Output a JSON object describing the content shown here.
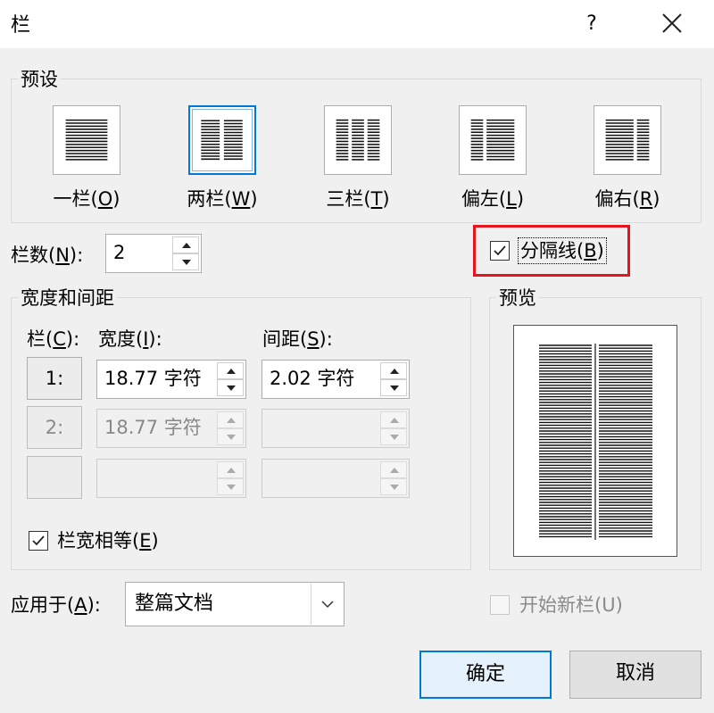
{
  "dialog": {
    "title": "栏",
    "help": "?"
  },
  "presets": {
    "label": "预设",
    "items": [
      {
        "text": "一栏(",
        "key": "O",
        "end": ")"
      },
      {
        "text": "两栏(",
        "key": "W",
        "end": ")"
      },
      {
        "text": "三栏(",
        "key": "T",
        "end": ")"
      },
      {
        "text": "偏左(",
        "key": "L",
        "end": ")"
      },
      {
        "text": "偏右(",
        "key": "R",
        "end": ")"
      }
    ],
    "selected": "两栏"
  },
  "column_count": {
    "label": "栏数(",
    "key": "N",
    "end": "):",
    "value": "2"
  },
  "separator": {
    "label": "分隔线(",
    "key": "B",
    "end": ")",
    "checked": true
  },
  "width_spacing": {
    "label": "宽度和间距",
    "col_header": {
      "text": "栏(",
      "key": "C",
      "end": "):"
    },
    "width_header": {
      "text": "宽度(",
      "key": "I",
      "end": "):"
    },
    "spacing_header": {
      "text": "间距(",
      "key": "S",
      "end": "):"
    },
    "rows": [
      {
        "num": "1:",
        "width": "18.77 字符",
        "spacing": "2.02 字符",
        "enabled": true
      },
      {
        "num": "2:",
        "width": "18.77 字符",
        "spacing": "",
        "enabled": false
      },
      {
        "num": "",
        "width": "",
        "spacing": "",
        "enabled": false
      }
    ],
    "equal_width": {
      "text": "栏宽相等(",
      "key": "E",
      "end": ")",
      "checked": true
    }
  },
  "preview": {
    "label": "预览"
  },
  "apply_to": {
    "label": "应用于(",
    "key": "A",
    "end": "):",
    "value": "整篇文档"
  },
  "new_column": {
    "label": "开始新栏(U)",
    "checked": false,
    "enabled": false
  },
  "buttons": {
    "ok": "确定",
    "cancel": "取消"
  },
  "colors": {
    "accent": "#0078d7",
    "highlight": "#e8141c"
  }
}
